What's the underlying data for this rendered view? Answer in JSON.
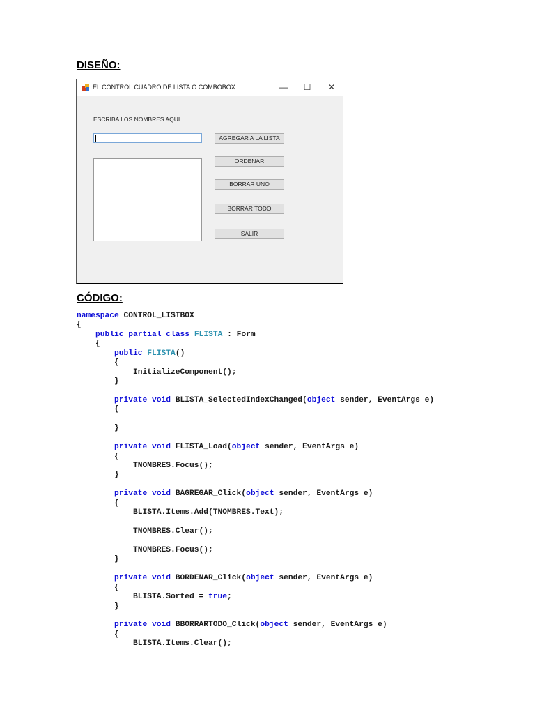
{
  "design_heading": "DISEÑO:",
  "code_heading": "CÓDIGO:",
  "form": {
    "title": "EL CONTROL CUADRO DE LISTA O COMBOBOX",
    "minimize": "—",
    "maximize": "☐",
    "close": "✕",
    "label": "ESCRIBA LOS NOMBRES AQUI",
    "input_value": "",
    "buttons": {
      "add": "AGREGAR A LA LISTA",
      "sort": "ORDENAR",
      "delete_one": "BORRAR UNO",
      "delete_all": "BORRAR TODO",
      "exit": "SALIR"
    }
  },
  "colors": {
    "keyword": "#1010d8",
    "type": "#2b91af"
  },
  "code_lines": [
    [
      [
        "k",
        "namespace"
      ],
      [
        "p",
        " CONTROL_LISTBOX"
      ]
    ],
    [
      [
        "p",
        "{"
      ]
    ],
    [
      [
        "p",
        "    "
      ],
      [
        "k",
        "public partial class"
      ],
      [
        "p",
        " "
      ],
      [
        "t",
        "FLISTA"
      ],
      [
        "p",
        " : Form"
      ]
    ],
    [
      [
        "p",
        "    {"
      ]
    ],
    [
      [
        "p",
        "        "
      ],
      [
        "k",
        "public"
      ],
      [
        "p",
        " "
      ],
      [
        "t",
        "FLISTA"
      ],
      [
        "p",
        "()"
      ]
    ],
    [
      [
        "p",
        "        {"
      ]
    ],
    [
      [
        "p",
        "            InitializeComponent();"
      ]
    ],
    [
      [
        "p",
        "        }"
      ]
    ],
    [],
    [
      [
        "p",
        "        "
      ],
      [
        "k",
        "private void"
      ],
      [
        "p",
        " BLISTA_SelectedIndexChanged("
      ],
      [
        "k",
        "object"
      ],
      [
        "p",
        " sender, EventArgs e)"
      ]
    ],
    [
      [
        "p",
        "        {"
      ]
    ],
    [],
    [
      [
        "p",
        "        }"
      ]
    ],
    [],
    [
      [
        "p",
        "        "
      ],
      [
        "k",
        "private void"
      ],
      [
        "p",
        " FLISTA_Load("
      ],
      [
        "k",
        "object"
      ],
      [
        "p",
        " sender, EventArgs e)"
      ]
    ],
    [
      [
        "p",
        "        {"
      ]
    ],
    [
      [
        "p",
        "            TNOMBRES.Focus();"
      ]
    ],
    [
      [
        "p",
        "        }"
      ]
    ],
    [],
    [
      [
        "p",
        "        "
      ],
      [
        "k",
        "private void"
      ],
      [
        "p",
        " BAGREGAR_Click("
      ],
      [
        "k",
        "object"
      ],
      [
        "p",
        " sender, EventArgs e)"
      ]
    ],
    [
      [
        "p",
        "        {"
      ]
    ],
    [
      [
        "p",
        "            BLISTA.Items.Add(TNOMBRES.Text);"
      ]
    ],
    [],
    [
      [
        "p",
        "            TNOMBRES.Clear();"
      ]
    ],
    [],
    [
      [
        "p",
        "            TNOMBRES.Focus();"
      ]
    ],
    [
      [
        "p",
        "        }"
      ]
    ],
    [],
    [
      [
        "p",
        "        "
      ],
      [
        "k",
        "private void"
      ],
      [
        "p",
        " BORDENAR_Click("
      ],
      [
        "k",
        "object"
      ],
      [
        "p",
        " sender, EventArgs e)"
      ]
    ],
    [
      [
        "p",
        "        {"
      ]
    ],
    [
      [
        "p",
        "            BLISTA.Sorted = "
      ],
      [
        "k",
        "true"
      ],
      [
        "p",
        ";"
      ]
    ],
    [
      [
        "p",
        "        }"
      ]
    ],
    [],
    [
      [
        "p",
        "        "
      ],
      [
        "k",
        "private void"
      ],
      [
        "p",
        " BBORRARTODO_Click("
      ],
      [
        "k",
        "object"
      ],
      [
        "p",
        " sender, EventArgs e)"
      ]
    ],
    [
      [
        "p",
        "        {"
      ]
    ],
    [
      [
        "p",
        "            BLISTA.Items.Clear();"
      ]
    ]
  ]
}
